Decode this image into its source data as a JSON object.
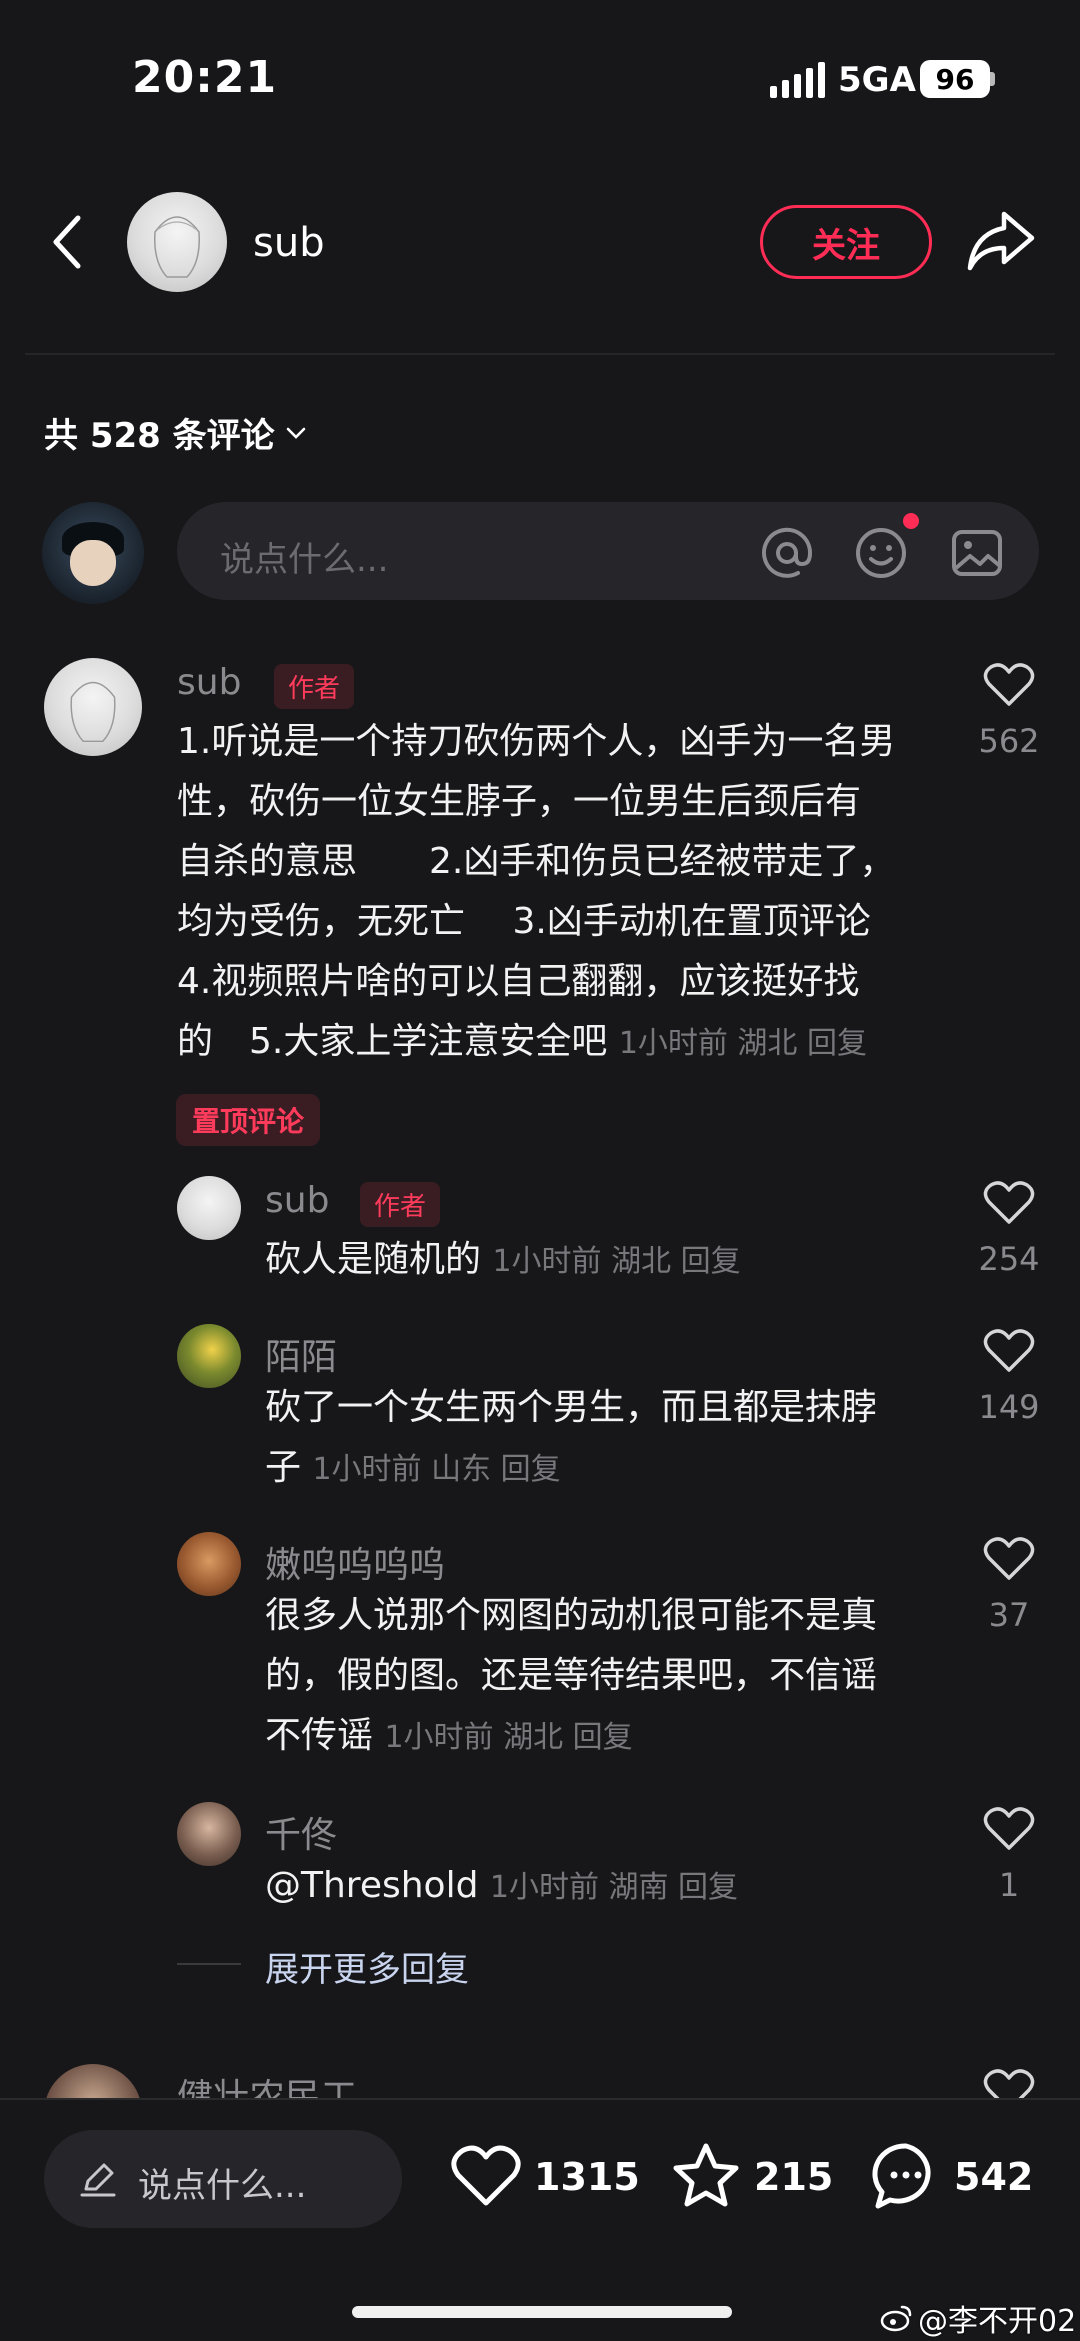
{
  "status_bar": {
    "time": "20:21",
    "network": "5GA",
    "battery": "96"
  },
  "header": {
    "name": "sub",
    "follow_label": "关注"
  },
  "comment_count": "共 528 条评论",
  "input": {
    "placeholder": "说点什么..."
  },
  "comments": [
    {
      "name": "sub",
      "tag": "作者",
      "lines": [
        "1.听说是一个持刀砍伤两个人，凶手为一名男",
        "性，砍伤一位女生脖子，一位男生后颈后有",
        "自杀的意思　　2.凶手和伤员已经被带走了，",
        "均为受伤，无死亡　 3.凶手动机在置顶评论",
        "4.视频照片啥的可以自己翻翻，应该挺好找",
        "的　5.大家上学注意安全吧"
      ],
      "meta": "1小时前 湖北 回复",
      "likes": "562",
      "pinned": "置顶评论"
    }
  ],
  "replies": [
    {
      "name": "sub",
      "tag": "作者",
      "lines": [
        "砍人是随机的"
      ],
      "meta": "1小时前 湖北 回复",
      "likes": "254"
    },
    {
      "name": "陌陌",
      "lines": [
        "砍了一个女生两个男生，而且都是抹脖",
        "子"
      ],
      "meta": "1小时前 山东 回复",
      "likes": "149"
    },
    {
      "name": "嫩呜呜呜呜",
      "lines": [
        "很多人说那个网图的动机很可能不是真",
        "的，假的图。还是等待结果吧，不信谣",
        "不传谣"
      ],
      "meta": "1小时前 湖北 回复",
      "likes": "37"
    },
    {
      "name": "千佟",
      "lines": [
        "@Threshold"
      ],
      "meta": "1小时前 湖南 回复",
      "likes": "1"
    }
  ],
  "expand_label": "展开更多回复",
  "next_comment": {
    "name": "健壮农民工"
  },
  "bottom_bar": {
    "placeholder": "说点什么...",
    "likes": "1315",
    "favorites": "215",
    "comments": "542"
  },
  "watermark": "@李不开02",
  "colors": {
    "accent": "#ff2d55",
    "background": "#17171a",
    "link": "#c9d4ee"
  }
}
